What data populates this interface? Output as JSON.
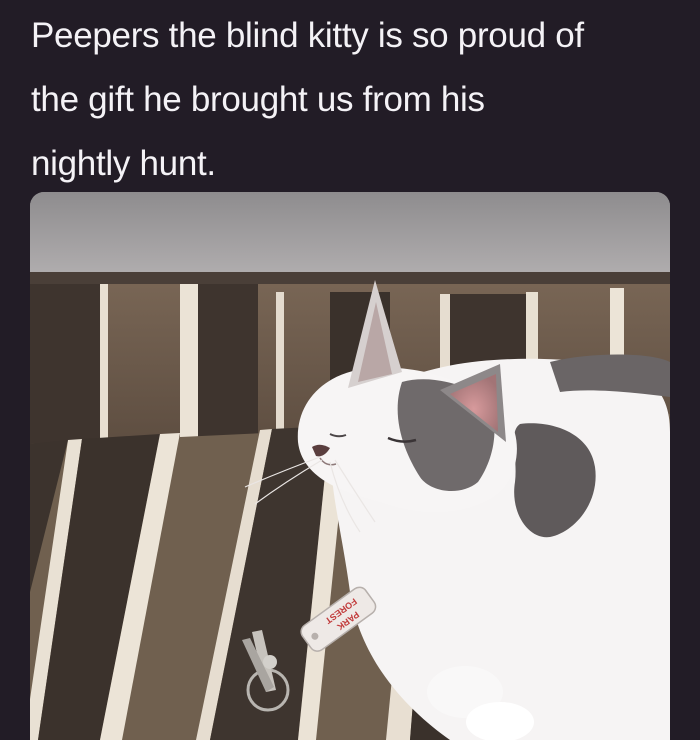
{
  "post": {
    "caption_line_1": "Peepers the blind kitty is so proud of",
    "caption_line_2": "the gift he brought us from his",
    "caption_line_3": "nightly hunt."
  },
  "photo": {
    "subject": "cat-with-keys",
    "tag_text_1": "FOREST",
    "tag_text_2": "PARK"
  },
  "colors": {
    "background": "#221c26",
    "caption_text": "#f4f2f6",
    "wall": "#a9a7a8",
    "cushion_brown": "#6e5c4c",
    "cushion_dark": "#3b322c",
    "stripe_cream": "#e9e1d4",
    "cat_white": "#f6f4f4",
    "cat_gray": "#6a6566"
  }
}
